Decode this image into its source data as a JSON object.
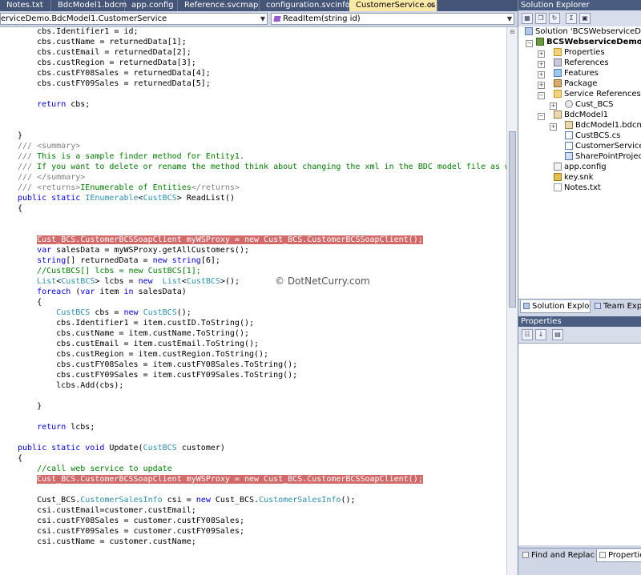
{
  "tabs": [
    {
      "label": "Notes.txt"
    },
    {
      "label": "BdcModel1.bdcm"
    },
    {
      "label": "app.config"
    },
    {
      "label": "Reference.svcmap"
    },
    {
      "label": "configuration.svcinfo"
    },
    {
      "label": "CustomerService.cs",
      "active": true,
      "close": "×"
    }
  ],
  "navbar": {
    "type_combo": "erviceDemo.BdcModel1.CustomerService",
    "member_combo": "ReadItem(string id)"
  },
  "watermark": "© DotNetCurry.com",
  "solution_explorer": {
    "title": "Solution Explorer",
    "tree": [
      {
        "label": "Solution 'BCSWebserviceDemo' (1"
      },
      {
        "label": "BCSWebserviceDemo"
      },
      {
        "label": "Properties"
      },
      {
        "label": "References"
      },
      {
        "label": "Features"
      },
      {
        "label": "Package"
      },
      {
        "label": "Service References"
      },
      {
        "label": "Cust_BCS"
      },
      {
        "label": "BdcModel1"
      },
      {
        "label": "BdcModel1.bdcm"
      },
      {
        "label": "CustBCS.cs"
      },
      {
        "label": "CustomerService.cs"
      },
      {
        "label": "SharePointProjectIte"
      },
      {
        "label": "app.config"
      },
      {
        "label": "key.snk"
      },
      {
        "label": "Notes.txt"
      }
    ],
    "tabs": [
      "Solution Explorer",
      "Team Expl"
    ]
  },
  "properties": {
    "title": "Properties"
  },
  "bottom_tabs": [
    "Find and Replace",
    "Properties"
  ]
}
